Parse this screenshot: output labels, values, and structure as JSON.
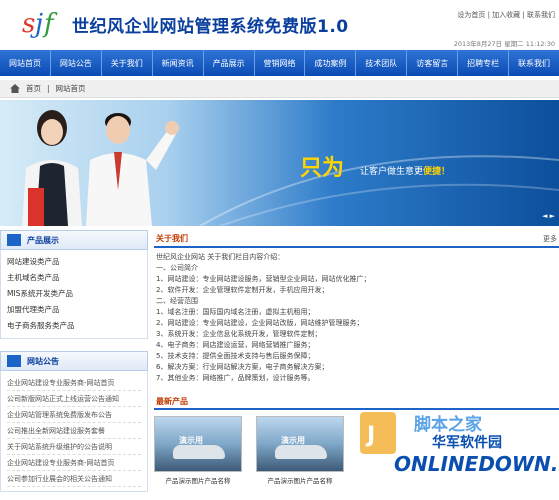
{
  "header": {
    "title": "世纪风企业网站管理系统免费版1.0",
    "top_links": "设为首页 | 加入收藏 | 联系我们",
    "date": "2013年8月27日 星期二 11:12:30"
  },
  "nav": {
    "items": [
      "网站首页",
      "网站公告",
      "关于我们",
      "新闻资讯",
      "产品展示",
      "营销网络",
      "成功案例",
      "技术团队",
      "访客留言",
      "招聘专栏",
      "联系我们"
    ]
  },
  "breadcrumb": {
    "home": "首页",
    "current": "网站首页"
  },
  "banner": {
    "big_text": "只为",
    "slogan_prefix": "让客户做生意更",
    "slogan_highlight": "便捷！",
    "control": "◄ ►"
  },
  "product_box": {
    "title": "产品展示",
    "items": [
      "网站建设类产品",
      "主机域名类产品",
      "MIS系统开发类产品",
      "加盟代理类产品",
      "电子商务服务类产品"
    ]
  },
  "notice_box": {
    "title": "网站公告",
    "items": [
      "企业网站建设专业服务商-网站首页",
      "公司新版网站正式上线运营公告通知",
      "企业网站管理系统免费版发布公告",
      "公司推出全新网站建设服务套餐",
      "关于网站系统升级维护的公告说明",
      "企业网站建设专业服务商-网站首页",
      "公司参加行业展会的相关公告通知"
    ]
  },
  "about": {
    "title": "关于我们",
    "more": "更多",
    "lines": [
      "世纪风企业网站 关于我们栏目内容介绍：",
      "一、公司简介",
      "1、网站建设：专业网站建设服务，营销型企业网站，网站优化推广；",
      "2、软件开发：企业管理软件定制开发，手机应用开发；",
      "二、经营范围",
      "1、域名注册：国际国内域名注册，虚拟主机租用；",
      "2、网站建设：专业网站建设，企业网站改版，网站维护管理服务；",
      "3、系统开发：企业信息化系统开发，管理软件定制；",
      "4、电子商务：网店建设运营，网络营销推广服务；",
      "5、技术支持：提供全面技术支持与售后服务保障；",
      "6、解决方案：行业网站解决方案，电子商务解决方案；",
      "7、其他业务：网络推广，品牌策划，设计服务等。"
    ]
  },
  "products": {
    "title": "最新产品",
    "items": [
      {
        "label": "演示用",
        "name": "产品演示图片产品名称"
      },
      {
        "label": "演示用",
        "name": "产品演示图片产品名称"
      }
    ]
  },
  "watermark": {
    "top": "脚本之家",
    "cn": "华军软件园",
    "en": "ONLINEDOWN.NET"
  },
  "colors": {
    "nav": "#0a4bb3",
    "title": "#0b3f9e",
    "accent": "#c03b00",
    "highlight": "#ffd400"
  }
}
